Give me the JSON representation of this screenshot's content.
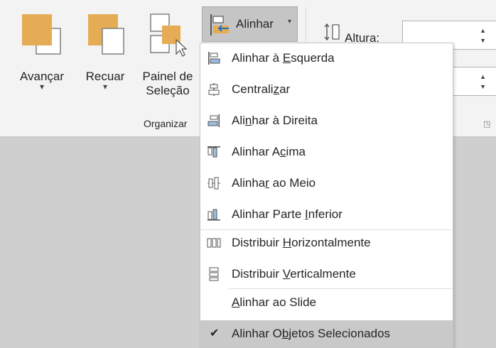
{
  "ribbon": {
    "forward": {
      "label": "Avançar",
      "dropdown": "▾"
    },
    "backward": {
      "label": "Recuar",
      "dropdown": "▾"
    },
    "selection_pane": {
      "label_line1": "Painel de",
      "label_line2": "Seleção"
    },
    "group_label": "Organizar",
    "align": {
      "label": "Alinhar",
      "caret": "▾"
    },
    "height": {
      "label": "Altura:",
      "value": "",
      "up": "▲",
      "down": "▼"
    },
    "width": {
      "value": "",
      "up": "▲",
      "down": "▼"
    },
    "launcher": "◳"
  },
  "menu": {
    "items": [
      {
        "pre": "Alinhar à ",
        "u": "E",
        "post": "squerda",
        "icon": "align-left-icon"
      },
      {
        "pre": "Centrali",
        "u": "z",
        "post": "ar",
        "icon": "align-center-icon"
      },
      {
        "pre": "Ali",
        "u": "n",
        "post": "har à Direita",
        "icon": "align-right-icon"
      },
      {
        "pre": "Alinhar A",
        "u": "c",
        "post": "ima",
        "icon": "align-top-icon"
      },
      {
        "pre": "Alinha",
        "u": "r",
        "post": " ao Meio",
        "icon": "align-middle-icon"
      },
      {
        "pre": "Alinhar Parte ",
        "u": "I",
        "post": "nferior",
        "icon": "align-bottom-icon"
      },
      {
        "pre": "Distribuir ",
        "u": "H",
        "post": "orizontalmente",
        "icon": "distribute-horizontal-icon"
      },
      {
        "pre": "Distribuir ",
        "u": "V",
        "post": "erticalmente",
        "icon": "distribute-vertical-icon"
      },
      {
        "pre": "",
        "u": "A",
        "post": "linhar ao Slide",
        "icon": ""
      },
      {
        "pre": "Alinhar O",
        "u": "b",
        "post": "jetos Selecionados",
        "icon": "",
        "check": "✔"
      }
    ]
  },
  "colors": {
    "accent": "#e6a94a",
    "accent_dark": "#d08b2c"
  }
}
